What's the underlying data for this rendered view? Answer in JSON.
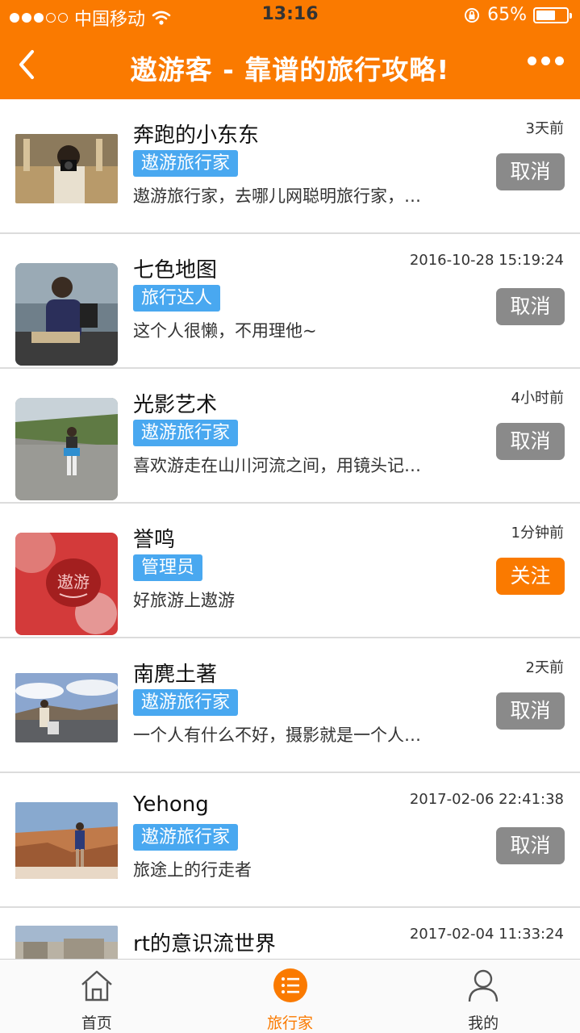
{
  "status_bar": {
    "carrier": "中国移动",
    "time": "13:16",
    "battery": "65%",
    "battery_level": 0.65
  },
  "header": {
    "title": "遨游客 - 靠谱的旅行攻略!"
  },
  "list": [
    {
      "name": "奔跑的小东东",
      "tag": "遨游旅行家",
      "desc": "遨游旅行家，去哪儿网聪明旅行家，…",
      "time": "3天前",
      "button": "取消",
      "button_type": "cancel"
    },
    {
      "name": "七色地图",
      "tag": "旅行达人",
      "desc": "这个人很懒，不用理他~",
      "time": "2016-10-28 15:19:24",
      "button": "取消",
      "button_type": "cancel"
    },
    {
      "name": "光影艺术",
      "tag": "遨游旅行家",
      "desc": "喜欢游走在山川河流之间，用镜头记…",
      "time": "4小时前",
      "button": "取消",
      "button_type": "cancel"
    },
    {
      "name": "誉鸣",
      "tag": "管理员",
      "desc": "好旅游上遨游",
      "time": "1分钟前",
      "button": "关注",
      "button_type": "follow",
      "avatar_text": "遨游"
    },
    {
      "name": "南麂土著",
      "tag": "遨游旅行家",
      "desc": "一个人有什么不好，摄影就是一个人…",
      "time": "2天前",
      "button": "取消",
      "button_type": "cancel"
    },
    {
      "name": "Yehong",
      "tag": "遨游旅行家",
      "desc": "旅途上的行走者",
      "time": "2017-02-06 22:41:38",
      "button": "取消",
      "button_type": "cancel"
    },
    {
      "name": "rt的意识流世界",
      "time": "2017-02-04 11:33:24"
    }
  ],
  "tabs": [
    {
      "label": "首页",
      "icon": "home-icon"
    },
    {
      "label": "旅行家",
      "icon": "list-icon",
      "active": true
    },
    {
      "label": "我的",
      "icon": "user-icon"
    }
  ],
  "colors": {
    "brand": "#fa7a00",
    "tag": "#49a8f0",
    "cancel_button": "#8a8a8a"
  }
}
